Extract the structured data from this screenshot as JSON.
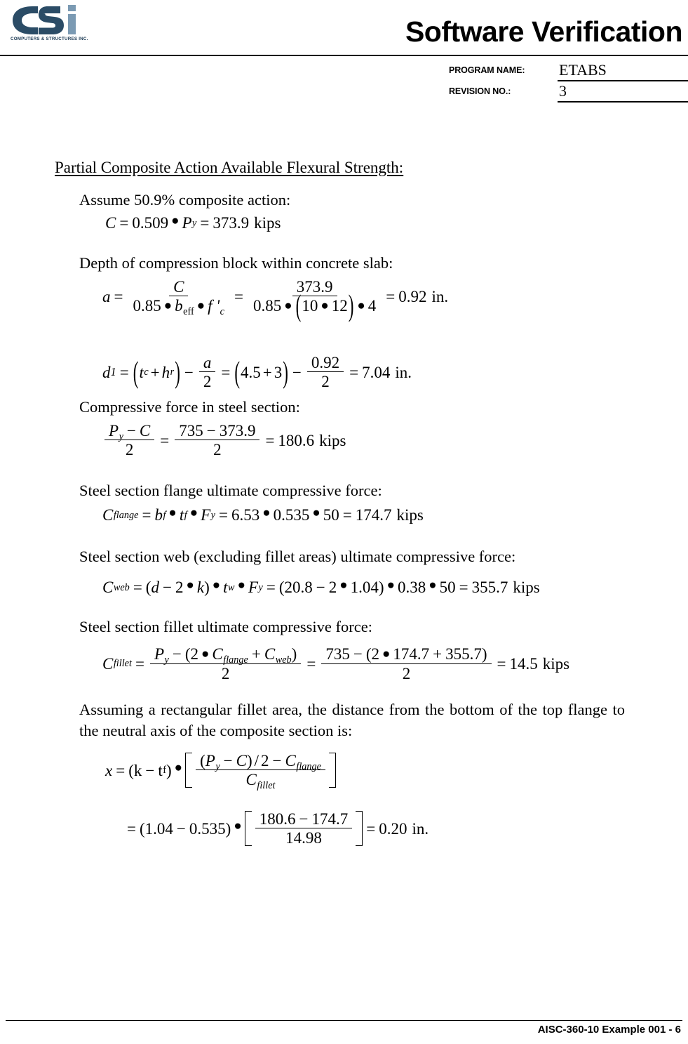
{
  "header": {
    "title": "Software Verification",
    "logo": {
      "letters": "CSI",
      "caption": "COMPUTERS & STRUCTURES INC.",
      "dark_color": "#2b4c66",
      "light_color": "#7b9ab3"
    },
    "program_name_label": "PROGRAM NAME:",
    "program_name_value": "ETABS",
    "revision_label": "REVISION NO.:",
    "revision_value": "3"
  },
  "body": {
    "section_heading": "Partial Composite Action Available Flexural Strength:",
    "line_assume": "Assume 50.9% composite action:",
    "eq_C": {
      "lhs": "C",
      "coefficient": "0.509",
      "var": "P",
      "var_sub": "y",
      "result": "373.9",
      "unit": "kips"
    },
    "line_depth": "Depth of compression block within concrete slab:",
    "eq_a": {
      "lhs": "a",
      "num1": "C",
      "den1_c": "0.85",
      "den1_b": "b",
      "den1_b_sub": "eff",
      "den1_f": "f '",
      "den1_f_sub": "c",
      "num2": "373.9",
      "den2": "0.85",
      "den2_p1": "10",
      "den2_p2": "12",
      "den2_last": "4",
      "result": "0.92",
      "unit": "in."
    },
    "eq_d1": {
      "lhs": "d",
      "lhs_sub": "1",
      "t": "t",
      "t_sub": "c",
      "h": "h",
      "h_sub": "r",
      "a_num": "a",
      "a_den": "2",
      "v1": "4.5",
      "v2": "3",
      "n_num": "0.92",
      "n_den": "2",
      "result": "7.04",
      "unit": "in."
    },
    "line_compressive": "Compressive force in steel section:",
    "eq_PyC": {
      "num_P": "P",
      "num_P_sub": "y",
      "num_C": "C",
      "den": "2",
      "num2_a": "735",
      "num2_b": "373.9",
      "den2": "2",
      "result": "180.6",
      "unit": "kips"
    },
    "line_flange": "Steel section flange ultimate compressive force:",
    "eq_Cflange": {
      "lhs": "C",
      "lhs_sub": "flange",
      "b": "b",
      "b_sub": "f",
      "t": "t",
      "t_sub": "f",
      "F": "F",
      "F_sub": "y",
      "v1": "6.53",
      "v2": "0.535",
      "v3": "50",
      "result": "174.7",
      "unit": "kips"
    },
    "line_web": "Steel section web (excluding fillet areas) ultimate compressive force:",
    "eq_Cweb": {
      "lhs": "C",
      "lhs_sub": "web",
      "d": "d",
      "two": "2",
      "k": "k",
      "t": "t",
      "t_sub": "w",
      "F": "F",
      "F_sub": "y",
      "v1": "20.8",
      "v2": "2",
      "v3": "1.04",
      "v4": "0.38",
      "v5": "50",
      "result": "355.7",
      "unit": "kips"
    },
    "line_fillet": "Steel section fillet ultimate compressive force:",
    "eq_Cfillet": {
      "lhs": "C",
      "lhs_sub": "fillet",
      "P": "P",
      "P_sub": "y",
      "two": "2",
      "Cf": "C",
      "Cf_sub": "flange",
      "Cw": "C",
      "Cw_sub": "web",
      "den": "2",
      "n1": "735",
      "n2": "2",
      "n3": "174.7",
      "n4": "355.7",
      "den2": "2",
      "result": "14.5",
      "unit": "kips"
    },
    "para_assuming": "Assuming a rectangular fillet area, the distance from the bottom of the top flange to the neutral axis of the composite section is:",
    "eq_x": {
      "lhs": "x",
      "k": "k",
      "t": "t",
      "t_sub": "f",
      "P": "P",
      "P_sub": "y",
      "C": "C",
      "two": "2",
      "Cflange": "C",
      "Cflange_sub": "flange",
      "Cfillet": "C",
      "Cfillet_sub": "fillet",
      "v1": "1.04",
      "v2": "0.535",
      "n_num_a": "180.6",
      "n_num_b": "174.7",
      "n_den": "14.98",
      "result": "0.20",
      "unit": "in."
    }
  },
  "footer": {
    "text": "AISC-360-10 Example 001 - 6"
  }
}
